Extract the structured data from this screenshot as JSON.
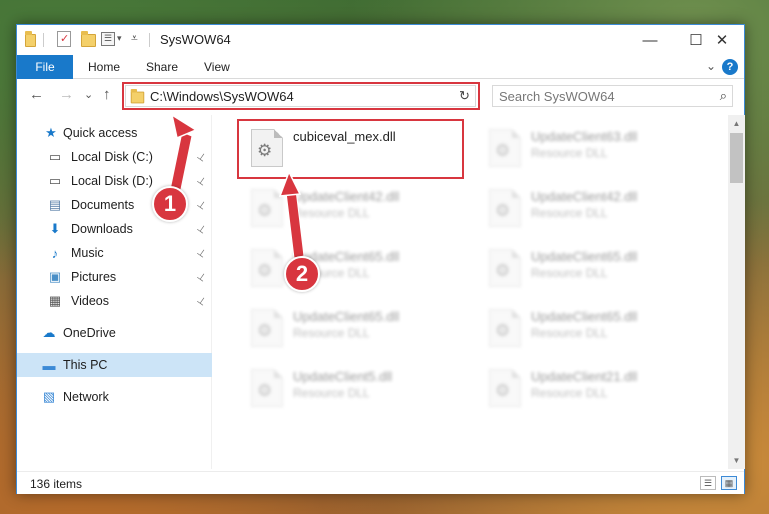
{
  "window": {
    "title": "SysWOW64",
    "minimize_glyph": "—",
    "maximize_glyph": "☐",
    "close_glyph": "✕"
  },
  "ribbon": {
    "file": "File",
    "home": "Home",
    "share": "Share",
    "view": "View",
    "help": "?",
    "expand_glyph": "⌄"
  },
  "nav": {
    "back_glyph": "←",
    "forward_glyph": "→",
    "recent_glyph": "⌄",
    "up_glyph": "↑",
    "address": "C:\\Windows\\SysWOW64",
    "address_dropdown_glyph": "⌄",
    "refresh_glyph": "↻",
    "search_placeholder": "Search SysWOW64",
    "search_glyph": "⌕"
  },
  "sidebar": {
    "items": [
      {
        "label": "Quick access",
        "icon": "star-icon",
        "glyph": "★",
        "color": "#1979ca",
        "pinned": false
      },
      {
        "label": "Local Disk (C:)",
        "icon": "drive-icon",
        "glyph": "▭",
        "color": "#555555",
        "pinned": true
      },
      {
        "label": "Local Disk (D:)",
        "icon": "drive-icon",
        "glyph": "▭",
        "color": "#555555",
        "pinned": true
      },
      {
        "label": "Documents",
        "icon": "documents-icon",
        "glyph": "▤",
        "color": "#5a7fa8",
        "pinned": true
      },
      {
        "label": "Downloads",
        "icon": "downloads-icon",
        "glyph": "⬇",
        "color": "#1979ca",
        "pinned": true
      },
      {
        "label": "Music",
        "icon": "music-icon",
        "glyph": "♪",
        "color": "#1979ca",
        "pinned": true
      },
      {
        "label": "Pictures",
        "icon": "pictures-icon",
        "glyph": "▣",
        "color": "#4a8fc7",
        "pinned": true
      },
      {
        "label": "Videos",
        "icon": "videos-icon",
        "glyph": "▦",
        "color": "#555555",
        "pinned": true
      },
      {
        "label": "OneDrive",
        "icon": "onedrive-icon",
        "glyph": "☁",
        "color": "#1979ca",
        "pinned": false
      },
      {
        "label": "This PC",
        "icon": "computer-icon",
        "glyph": "▬",
        "color": "#3c8ad6",
        "pinned": false
      },
      {
        "label": "Network",
        "icon": "network-icon",
        "glyph": "▧",
        "color": "#3c8ad6",
        "pinned": false
      }
    ],
    "pin_glyph": "📌"
  },
  "files": [
    {
      "name": "cubiceval_mex.dll",
      "type": "",
      "highlight": true
    },
    {
      "name": "UpdateClient63.dll",
      "type": "Resource DLL"
    },
    {
      "name": "UpdateClient42.dll",
      "type": "Resource DLL"
    },
    {
      "name": "UpdateClient42.dll",
      "type": "Resource DLL"
    },
    {
      "name": "UpdateClient65.dll",
      "type": "Resource DLL"
    },
    {
      "name": "UpdateClient65.dll",
      "type": "Resource DLL"
    },
    {
      "name": "UpdateClient65.dll",
      "type": "Resource DLL"
    },
    {
      "name": "UpdateClient65.dll",
      "type": "Resource DLL"
    },
    {
      "name": "UpdateClient5.dll",
      "type": "Resource DLL"
    },
    {
      "name": "UpdateClient21.dll",
      "type": "Resource DLL"
    }
  ],
  "status": {
    "items_count": "136 items"
  },
  "callouts": {
    "one": "1",
    "two": "2"
  },
  "colors": {
    "accent": "#1979ca",
    "highlight_red": "#d8363f",
    "selected_bg": "#cce4f7"
  }
}
